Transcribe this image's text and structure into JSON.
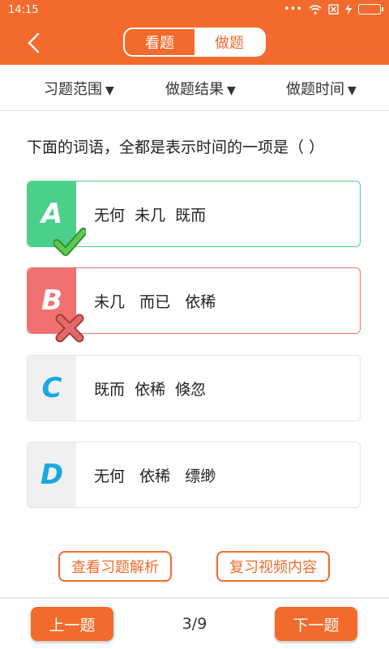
{
  "status": {
    "time": "14:15"
  },
  "header": {
    "tabs": [
      {
        "label": "看题"
      },
      {
        "label": "做题"
      }
    ]
  },
  "filters": [
    {
      "label": "习题范围"
    },
    {
      "label": "做题结果"
    },
    {
      "label": "做题时间"
    }
  ],
  "question": "下面的词语，全都是表示时间的一项是（    ）",
  "options": [
    {
      "letter": "A",
      "text": "无何  未几  既而",
      "state": "correct"
    },
    {
      "letter": "B",
      "text": "未几   而已   依稀",
      "state": "wrong"
    },
    {
      "letter": "C",
      "text": "既而  依稀  倏忽",
      "state": "none"
    },
    {
      "letter": "D",
      "text": "无何   依稀   缥缈",
      "state": "none"
    }
  ],
  "actions": {
    "analysis": "查看习题解析",
    "video": "复习视频内容"
  },
  "nav": {
    "prev": "上一题",
    "next": "下一题",
    "page": "3/9"
  },
  "colors": {
    "accent": "#f36b2c",
    "correct": "#4bd08a",
    "wrong": "#f07171",
    "letter": "#1ba8dc"
  }
}
